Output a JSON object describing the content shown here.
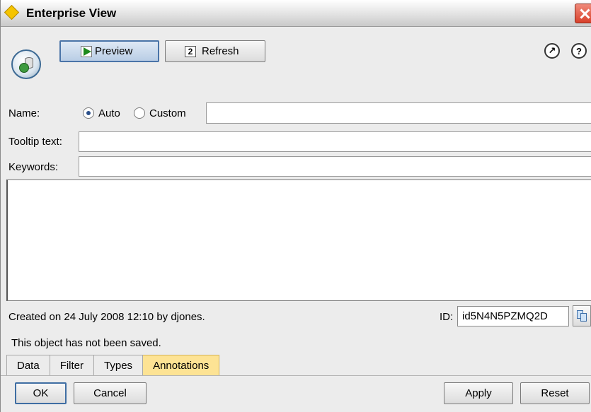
{
  "window": {
    "title": "Enterprise View"
  },
  "toolbar": {
    "preview_label": "Preview",
    "refresh_label": "Refresh",
    "launch_icon": "launch-icon",
    "help_icon": "help-icon",
    "help_glyph": "?",
    "launch_glyph": "↗"
  },
  "form": {
    "name_label": "Name:",
    "name_mode_auto": "Auto",
    "name_mode_custom": "Custom",
    "name_mode_selected": "Auto",
    "name_value": "",
    "tooltip_label": "Tooltip text:",
    "tooltip_value": "",
    "keywords_label": "Keywords:",
    "keywords_value": "",
    "annotation_text": ""
  },
  "info": {
    "created_text": "Created on 24 July 2008 12:10 by djones.",
    "id_label": "ID:",
    "id_value": "id5N4N5PZMQ2D",
    "saved_status": "This object has not been saved."
  },
  "tabs": [
    {
      "label": "Data",
      "active": false
    },
    {
      "label": "Filter",
      "active": false
    },
    {
      "label": "Types",
      "active": false
    },
    {
      "label": "Annotations",
      "active": true
    }
  ],
  "buttons": {
    "ok": "OK",
    "cancel": "Cancel",
    "apply": "Apply",
    "reset": "Reset"
  },
  "colors": {
    "active_tab": "#fde394",
    "close_button": "#d9412b",
    "title_icon": "#f5c400"
  }
}
